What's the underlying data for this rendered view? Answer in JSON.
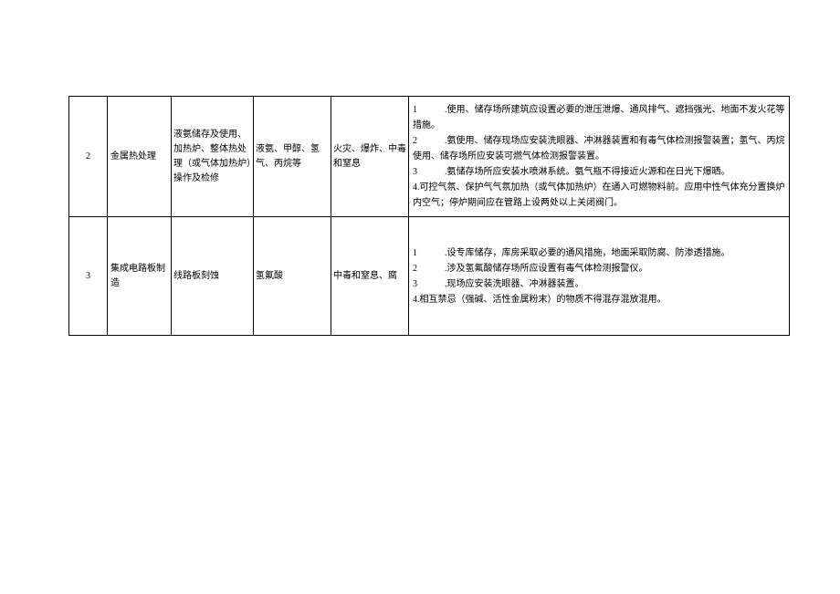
{
  "rows": [
    {
      "num": "2",
      "category": "金属热处理",
      "process": "液氨储存及使用、加热炉、整体热处理（或气体加热炉）操作及检修",
      "materials": "液氨、甲醇、氢气、丙烷等",
      "hazards": "火灾、爆炸、中毒和窒息",
      "measures": [
        "1　　　.使用、储存场所建筑应设置必要的泄压泄爆、通风排气、遮挡强光、地面不发火花等措施。",
        "2　　　.氨使用、储存现场应安装洗眼器、冲淋器装置和有毒气体检测报警装置；氢气、丙烷使用、储存场所应安装可燃气体检测报警装置。",
        "3　　　.氨储存场所应安装水喷淋系统。氨气瓶不得接近火源和在日光下爆晒。",
        "4.可控气氛、保护气气氛加热（或气体加热炉）在通入可燃物料前。应用中性气体充分置换炉内空气；停炉期间应在管路上设两处以上关闭阀门。"
      ]
    },
    {
      "num": "3",
      "category": "集成电路板制造",
      "process": "线路板刻蚀",
      "materials": "氢氟酸",
      "hazards": "中毒和窒息、腐",
      "measures": [
        "1　　　.设专库储存，库房采取必要的通风措施，地面采取防腐、防渗透措施。",
        "2　　　.涉及氢氟酸储存场所应设置有毒气体检测报警仪。",
        "3　　　.现场应安装洗眼器、冲淋器装置。",
        "4.相互禁忌（强碱、活性金属粉末）的物质不得混存混放混用。"
      ]
    }
  ]
}
